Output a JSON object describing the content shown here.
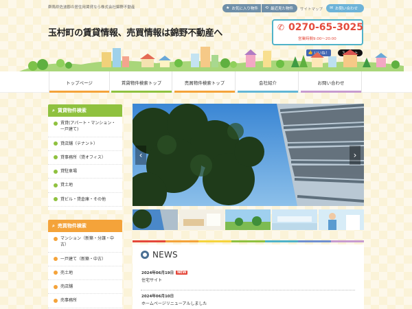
{
  "header": {
    "tagline": "群馬県佐波郡の居住用賃貸なら株式会社錦野不動産",
    "favorites_label": "お気に入り物件",
    "recent_label": "最近見た物件",
    "sitemap_label": "サイトマップ",
    "contact_label": "お問い合わせ",
    "main_title": "玉村町の賃貸情報、売買情報は錦野不動産へ",
    "phone": "0270-65-3025",
    "hours": "営業時間9:00～20:00",
    "fb_label": "いいね！",
    "x_label": "ポスト"
  },
  "nav": {
    "items": [
      {
        "label": "トップページ",
        "color": "#f4a33a"
      },
      {
        "label": "賃貸物件検索トップ",
        "color": "#8fc13f"
      },
      {
        "label": "売買物件検索トップ",
        "color": "#f4a33a"
      },
      {
        "label": "会社紹介",
        "color": "#62b6d6"
      },
      {
        "label": "お問い合わせ",
        "color": "#c79bd0"
      }
    ]
  },
  "sidebar": {
    "rent_title": "賃貸物件検索",
    "rent_items": [
      "賃貸(アパート・マンション・一戸建て)",
      "貸店舗（テナント）",
      "貸事務所（貸オフィス）",
      "貸駐車場",
      "貸土地",
      "貸ビル・貸倉庫・その他"
    ],
    "sale_title": "売買物件検索",
    "sale_items": [
      "マンション（新築・分譲・中古）",
      "一戸建て（新築・中古）",
      "売土地",
      "売店舗",
      "売事務所"
    ]
  },
  "news": {
    "title": "NEWS",
    "items": [
      {
        "date": "2024年06月19日",
        "badge": "NEW",
        "text": "住宅サイト"
      },
      {
        "date": "2024年06月10日",
        "text": "ホームページリニューアルしました"
      }
    ]
  },
  "colors": {
    "rent_accent": "#8fc13f",
    "sale_accent": "#f4a33a",
    "phone_red": "#e44b3c",
    "phone_border": "#4fb2c9"
  }
}
